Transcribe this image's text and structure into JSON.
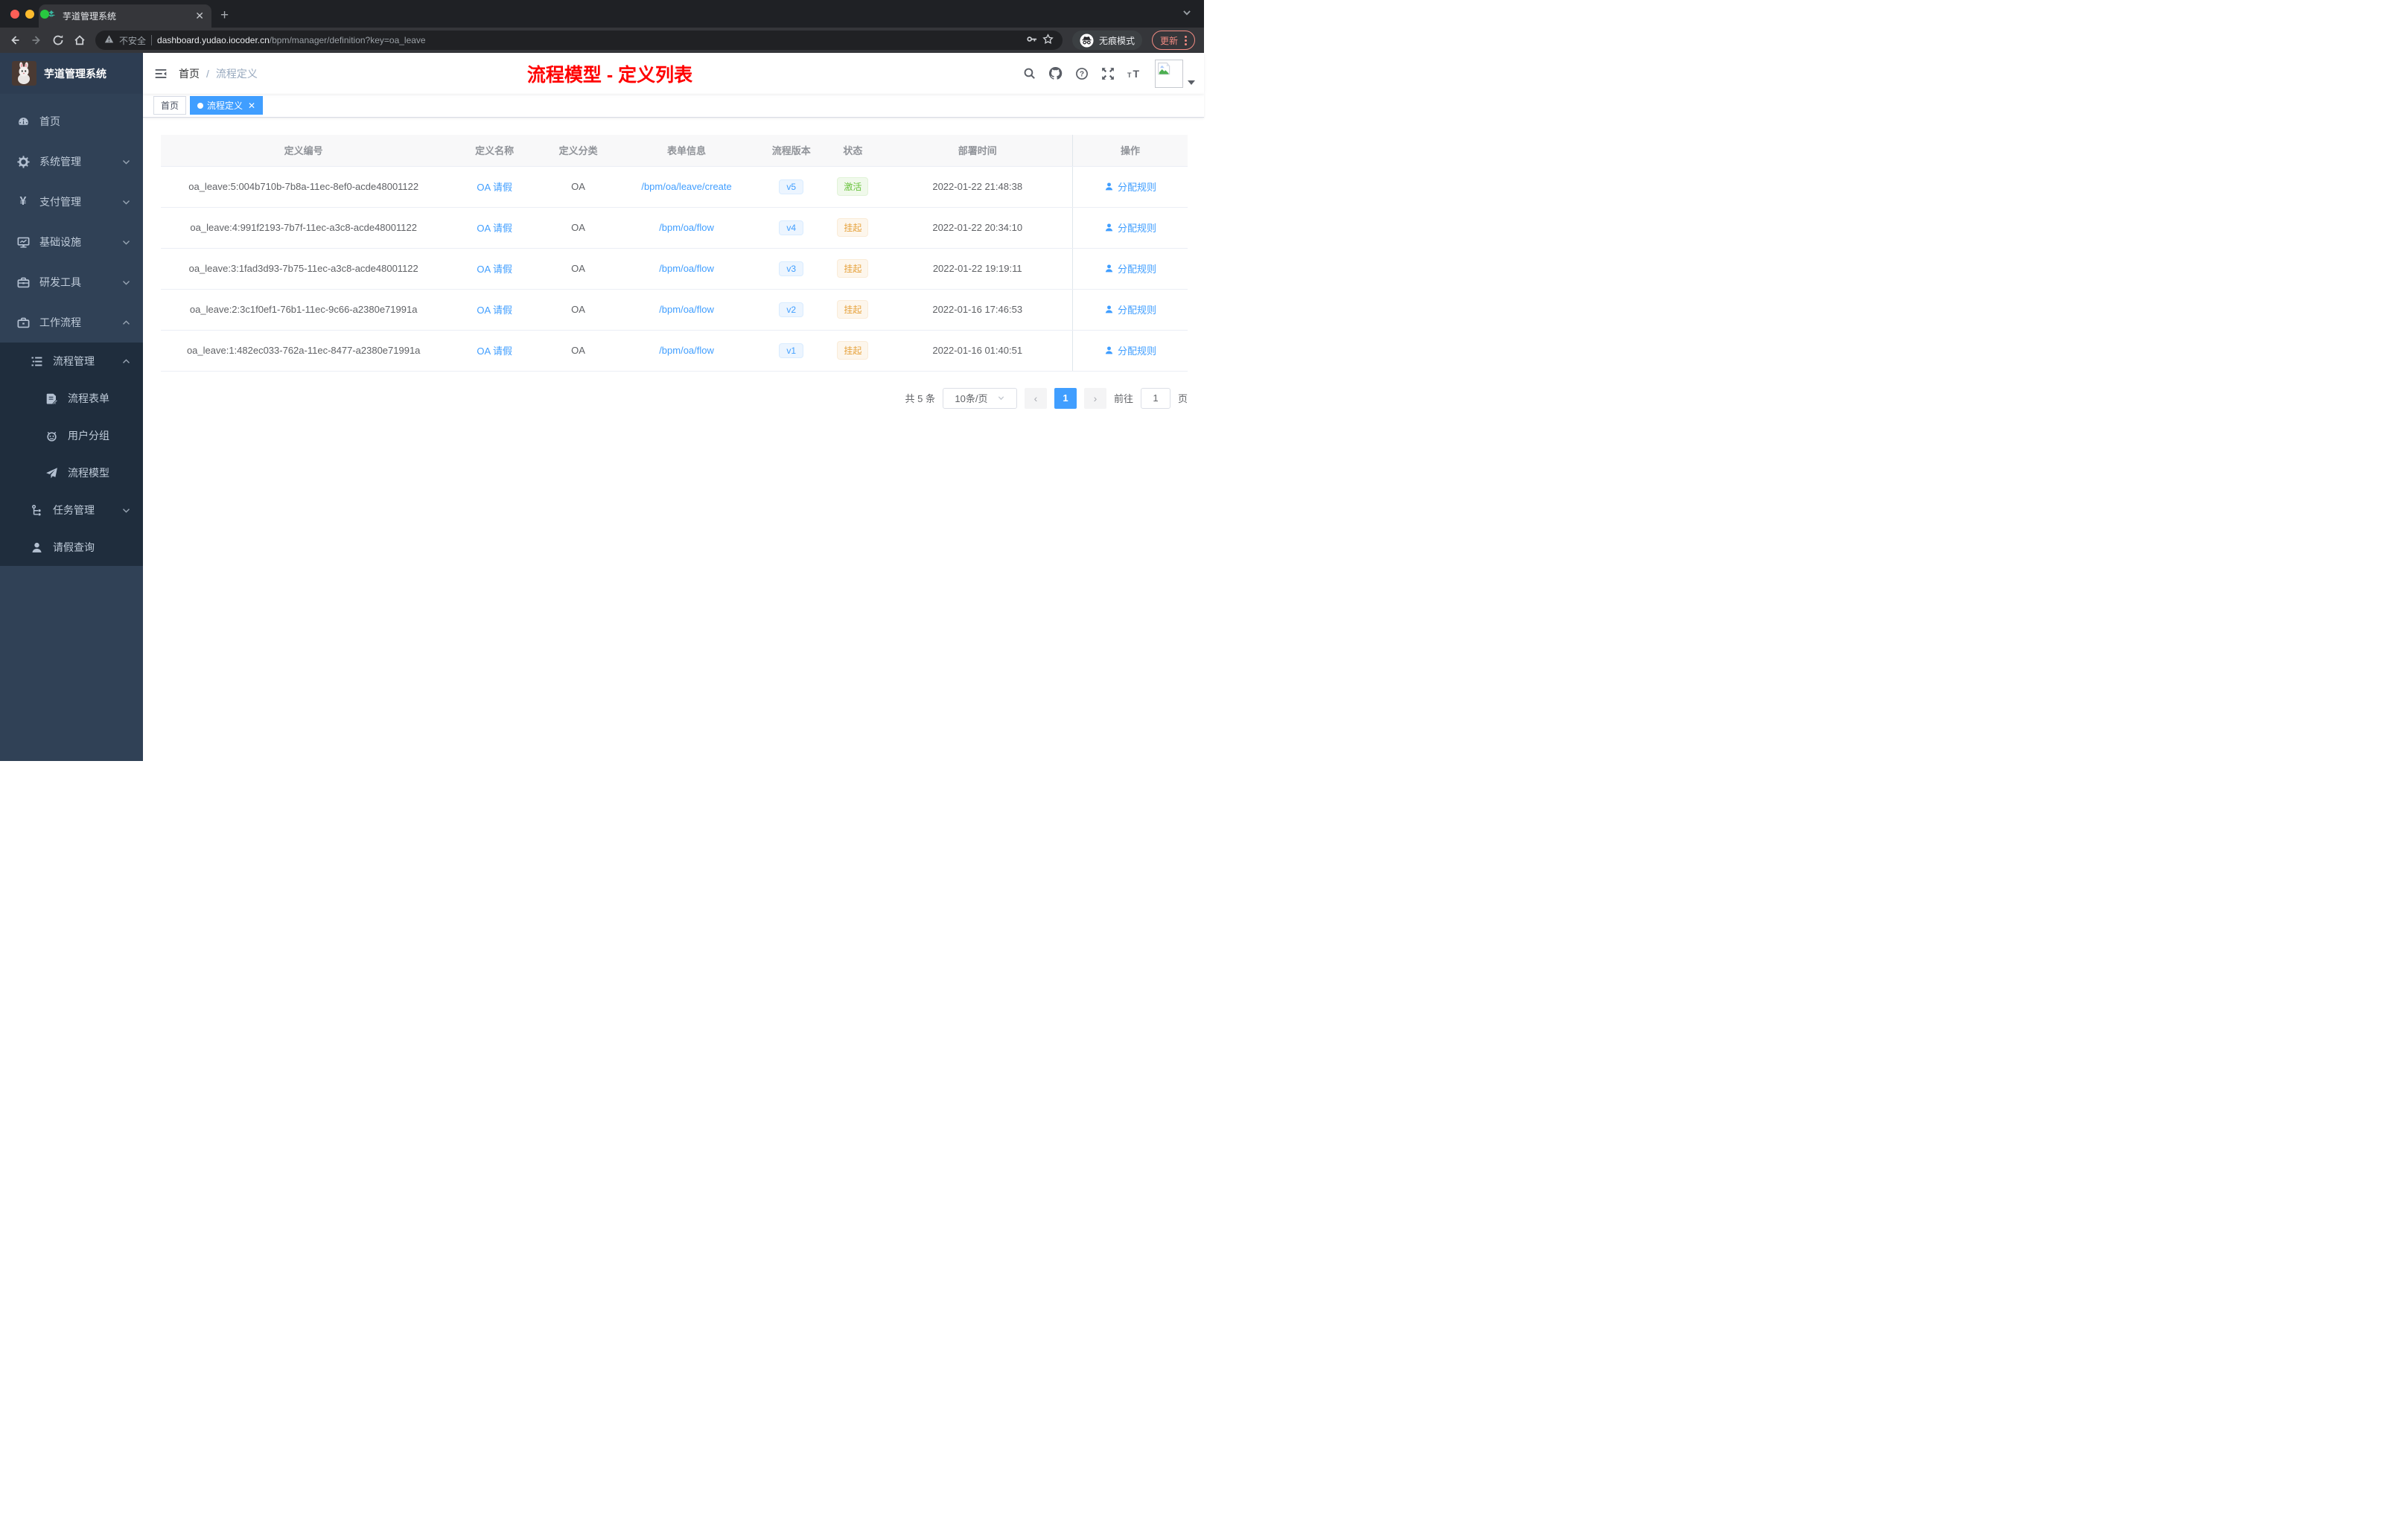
{
  "colors": {
    "accent": "#409eff",
    "success": "#67c23a",
    "warning": "#e6a23c",
    "annotation_red": "#ff0000",
    "sidebar_bg": "#304156",
    "submenu_bg": "#1f2d3d"
  },
  "chrome": {
    "tab_title": "芋道管理系统",
    "security_label": "不安全",
    "url_host": "dashboard.yudao.iocoder.cn",
    "url_path": "/bpm/manager/definition?key=oa_leave",
    "incognito_label": "无痕模式",
    "update_label": "更新"
  },
  "sidebar": {
    "app_title": "芋道管理系统",
    "items": [
      {
        "key": "home",
        "label": "首页",
        "icon": "dashboard",
        "level": 1,
        "chevron": null,
        "dark": false
      },
      {
        "key": "system",
        "label": "系统管理",
        "icon": "gear",
        "level": 1,
        "chevron": "down",
        "dark": false
      },
      {
        "key": "payment",
        "label": "支付管理",
        "icon": "yen",
        "level": 1,
        "chevron": "down",
        "dark": false
      },
      {
        "key": "infrastructure",
        "label": "基础设施",
        "icon": "monitor",
        "level": 1,
        "chevron": "down",
        "dark": false
      },
      {
        "key": "dev-tools",
        "label": "研发工具",
        "icon": "toolbox",
        "level": 1,
        "chevron": "down",
        "dark": false
      },
      {
        "key": "workflow",
        "label": "工作流程",
        "icon": "briefcase",
        "level": 1,
        "chevron": "up",
        "dark": false
      },
      {
        "key": "process-mgmt",
        "label": "流程管理",
        "icon": "list",
        "level": 2,
        "chevron": "up",
        "dark": true
      },
      {
        "key": "process-form",
        "label": "流程表单",
        "icon": "form",
        "level": 3,
        "chevron": null,
        "dark": true
      },
      {
        "key": "user-group",
        "label": "用户分组",
        "icon": "robot",
        "level": 3,
        "chevron": null,
        "dark": true
      },
      {
        "key": "process-model",
        "label": "流程模型",
        "icon": "send",
        "level": 3,
        "chevron": null,
        "dark": true
      },
      {
        "key": "task-mgmt",
        "label": "任务管理",
        "icon": "tree",
        "level": 2,
        "chevron": "down",
        "dark": true
      },
      {
        "key": "leave-query",
        "label": "请假查询",
        "icon": "user",
        "level": 2,
        "chevron": null,
        "dark": true
      }
    ]
  },
  "navbar": {
    "breadcrumb": [
      "首页",
      "流程定义"
    ],
    "breadcrumb_separator": "/",
    "annotation": "流程模型 - 定义列表"
  },
  "tags": [
    {
      "label": "首页",
      "active": false
    },
    {
      "label": "流程定义",
      "active": true
    }
  ],
  "table": {
    "headers": [
      "定义编号",
      "定义名称",
      "定义分类",
      "表单信息",
      "流程版本",
      "状态",
      "部署时间",
      "操作"
    ],
    "action_label": "分配规则",
    "rows": [
      {
        "id": "oa_leave:5:004b710b-7b8a-11ec-8ef0-acde48001122",
        "name": "OA 请假",
        "category": "OA",
        "form": "/bpm/oa/leave/create",
        "version": "v5",
        "status": "激活",
        "status_type": "success",
        "deploy_time": "2022-01-22 21:48:38"
      },
      {
        "id": "oa_leave:4:991f2193-7b7f-11ec-a3c8-acde48001122",
        "name": "OA 请假",
        "category": "OA",
        "form": "/bpm/oa/flow",
        "version": "v4",
        "status": "挂起",
        "status_type": "warning",
        "deploy_time": "2022-01-22 20:34:10"
      },
      {
        "id": "oa_leave:3:1fad3d93-7b75-11ec-a3c8-acde48001122",
        "name": "OA 请假",
        "category": "OA",
        "form": "/bpm/oa/flow",
        "version": "v3",
        "status": "挂起",
        "status_type": "warning",
        "deploy_time": "2022-01-22 19:19:11"
      },
      {
        "id": "oa_leave:2:3c1f0ef1-76b1-11ec-9c66-a2380e71991a",
        "name": "OA 请假",
        "category": "OA",
        "form": "/bpm/oa/flow",
        "version": "v2",
        "status": "挂起",
        "status_type": "warning",
        "deploy_time": "2022-01-16 17:46:53"
      },
      {
        "id": "oa_leave:1:482ec033-762a-11ec-8477-a2380e71991a",
        "name": "OA 请假",
        "category": "OA",
        "form": "/bpm/oa/flow",
        "version": "v1",
        "status": "挂起",
        "status_type": "warning",
        "deploy_time": "2022-01-16 01:40:51"
      }
    ]
  },
  "pagination": {
    "total_text": "共 5 条",
    "page_size_label": "10条/页",
    "current_page": "1",
    "goto_prefix": "前往",
    "goto_value": "1",
    "goto_suffix": "页"
  }
}
